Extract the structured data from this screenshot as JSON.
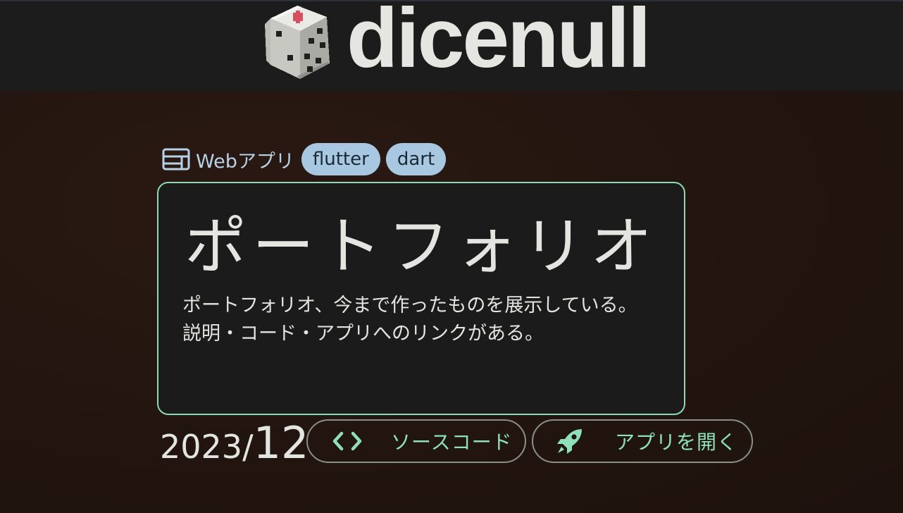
{
  "header": {
    "logo_text": "dicenull",
    "logo_icon": "dice-icon"
  },
  "work": {
    "category": {
      "icon": "web-app-icon",
      "label": "Webアプリ"
    },
    "tags": [
      "flutter",
      "dart"
    ],
    "title": "ポートフォリオ",
    "description_lines": [
      "ポートフォリオ、今まで作ったものを展示している。",
      "説明・コード・アプリへのリンクがある。"
    ],
    "date": {
      "year_prefix": "2023/",
      "month": "12"
    },
    "buttons": {
      "source": {
        "icon": "code-icon",
        "label": "ソースコード"
      },
      "app": {
        "icon": "rocket-icon",
        "label": "アプリを開く"
      }
    }
  },
  "colors": {
    "accent": "#8ee0bb",
    "card_border": "#8dd9b4",
    "tag_bg": "#a8c8e1",
    "category_text": "#b7d1e6",
    "header_bg": "#1b1c1b",
    "body_bg": "#22150f"
  }
}
